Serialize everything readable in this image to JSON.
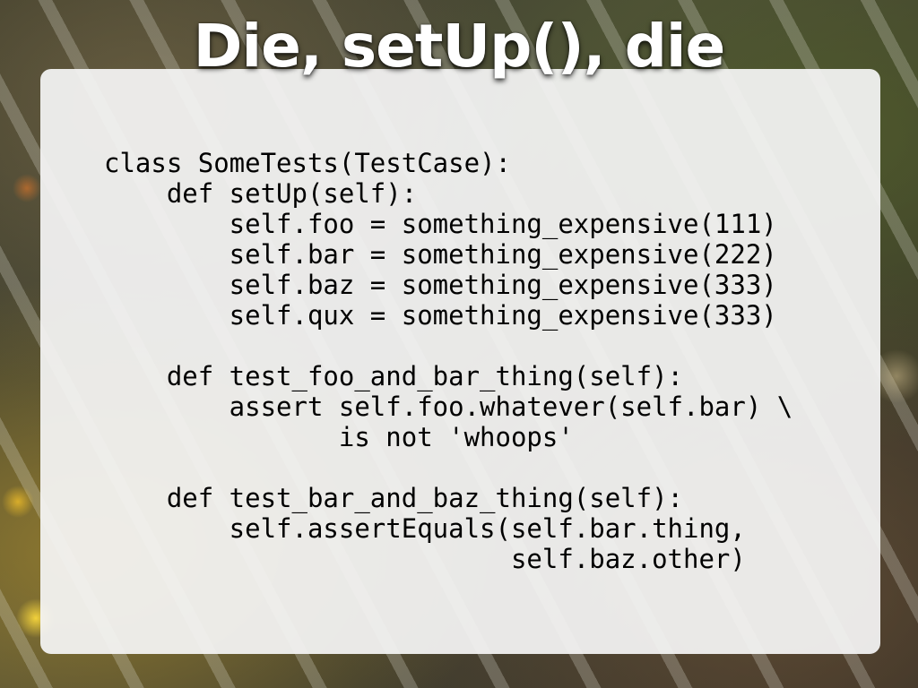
{
  "slide": {
    "title": "Die, setUp(), die",
    "code_lines": [
      "class SomeTests(TestCase):",
      "    def setUp(self):",
      "        self.foo = something_expensive(111)",
      "        self.bar = something_expensive(222)",
      "        self.baz = something_expensive(333)",
      "        self.qux = something_expensive(333)",
      "",
      "    def test_foo_and_bar_thing(self):",
      "        assert self.foo.whatever(self.bar) \\",
      "               is not 'whoops'",
      "",
      "    def test_bar_and_baz_thing(self):",
      "        self.assertEquals(self.bar.thing,",
      "                          self.baz.other)"
    ]
  }
}
